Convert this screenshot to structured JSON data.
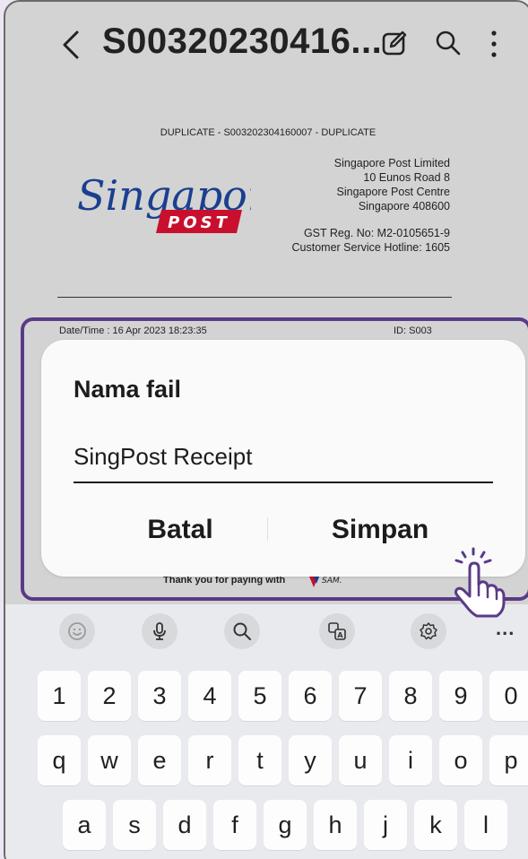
{
  "appbar": {
    "title": "S00320230416...",
    "back_icon": "back-arrow-icon",
    "edit_icon": "edit-icon",
    "search_icon": "search-icon",
    "more_icon": "more-vert-icon"
  },
  "document": {
    "header": "DUPLICATE - S003202304160007 - DUPLICATE",
    "logo_script": "Singapore",
    "logo_badge": "POST",
    "address_lines": [
      "Singapore Post Limited",
      "10 Eunos Road 8",
      "Singapore Post Centre",
      "Singapore 408600"
    ],
    "gst": "GST Reg. No: M2-0105651-9",
    "hotline": "Customer Service Hotline: 1605",
    "datetime": "Date/Time : 16 Apr 2023 18:23:35",
    "id": "ID: S003",
    "thanks": "Thank you for paying with",
    "thanks_logo": "SAM."
  },
  "dialog": {
    "title": "Nama fail",
    "filename_value": "SingPost Receipt",
    "cancel_label": "Batal",
    "save_label": "Simpan"
  },
  "keyboard": {
    "toolbar_icons": [
      "emoji-icon",
      "mic-icon",
      "search-icon",
      "translate-icon",
      "settings-icon"
    ],
    "more_label": "...",
    "rows": [
      [
        "1",
        "2",
        "3",
        "4",
        "5",
        "6",
        "7",
        "8",
        "9",
        "0"
      ],
      [
        "q",
        "w",
        "e",
        "r",
        "t",
        "y",
        "u",
        "i",
        "o",
        "p"
      ],
      [
        "a",
        "s",
        "d",
        "f",
        "g",
        "h",
        "j",
        "k",
        "l"
      ]
    ]
  },
  "colors": {
    "highlight": "#5a3a86",
    "singpost_blue": "#1b3f8f",
    "singpost_red": "#c8102e"
  }
}
